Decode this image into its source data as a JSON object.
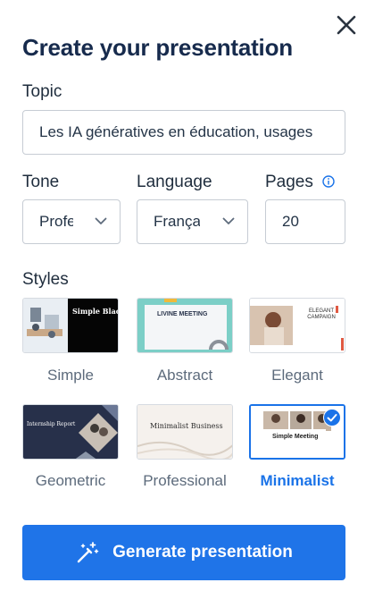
{
  "dialog": {
    "title": "Create your presentation",
    "close_icon": "close-icon"
  },
  "topic": {
    "label": "Topic",
    "value": "Les IA génératives en éducation, usages"
  },
  "tone": {
    "label": "Tone",
    "value": "Professionnel"
  },
  "language": {
    "label": "Language",
    "value": "Français"
  },
  "pages": {
    "label": "Pages",
    "value": "20",
    "info_icon": "info-icon"
  },
  "styles": {
    "label": "Styles",
    "selected": "Minimalist",
    "items": [
      {
        "name": "Simple",
        "thumb_text": "Simple Black"
      },
      {
        "name": "Abstract",
        "thumb_text": "LIVINE MEETING"
      },
      {
        "name": "Elegant",
        "thumb_text": "ELEGANT CAMPAIGN"
      },
      {
        "name": "Geometric",
        "thumb_text": "Internship Report"
      },
      {
        "name": "Professional",
        "thumb_text": "Minimalist Business"
      },
      {
        "name": "Minimalist",
        "thumb_text": "Simple Meeting"
      }
    ]
  },
  "generate_button": {
    "label": "Generate presentation",
    "icon": "magic-wand-icon"
  },
  "colors": {
    "accent": "#1f74e8",
    "title": "#172b4d",
    "muted": "#5d6b7c"
  }
}
